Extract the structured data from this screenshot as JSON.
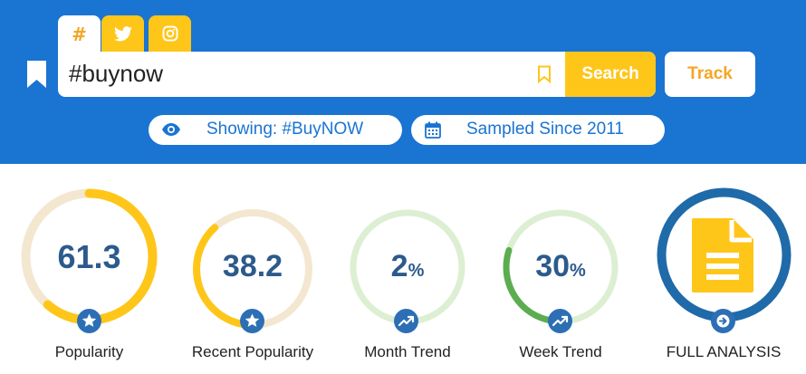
{
  "header": {
    "tabs": [
      {
        "name": "hashtag",
        "icon": "hashtag-icon",
        "label": "#",
        "active": true
      },
      {
        "name": "twitter",
        "icon": "twitter-icon",
        "active": false
      },
      {
        "name": "instagram",
        "icon": "instagram-icon",
        "active": false
      }
    ],
    "side_icon": "bookmark-icon",
    "search": {
      "value": "#buynow",
      "bookmark_icon": "bookmark-outline-icon",
      "button_label": "Search"
    },
    "track_label": "Track",
    "pills": [
      {
        "icon": "eye-icon",
        "label": "Showing: #BuyNOW"
      },
      {
        "icon": "calendar-icon",
        "label": "Sampled Since 2011"
      }
    ]
  },
  "metrics": [
    {
      "value": "61.3",
      "unit": "",
      "label": "Popularity",
      "fill_percent": 61.3,
      "badge_icon": "star-icon"
    },
    {
      "value": "38.2",
      "unit": "",
      "label": "Recent Popularity",
      "fill_percent": 38.2,
      "badge_icon": "star-icon"
    },
    {
      "value": "2",
      "unit": "%",
      "label": "Month Trend",
      "fill_percent": 2,
      "badge_icon": "trend-icon"
    },
    {
      "value": "30",
      "unit": "%",
      "label": "Week Trend",
      "fill_percent": 30,
      "badge_icon": "trend-icon"
    },
    {
      "value": "",
      "unit": "",
      "label": "FULL ANALYSIS",
      "badge_icon": "arrow-right-icon",
      "center_icon": "document-icon"
    }
  ],
  "colors": {
    "header_bg": "#1a74d2",
    "accent_yellow": "#ffc61a",
    "track_orange": "#f5a623",
    "popularity_track": "#f3e7d0",
    "trend_track": "#dcefd2",
    "trend_fill": "#5cad4f",
    "value_text": "#2c5a8c",
    "badge_bg": "#2c6fb5",
    "analysis_ring": "#1f6aa9"
  }
}
